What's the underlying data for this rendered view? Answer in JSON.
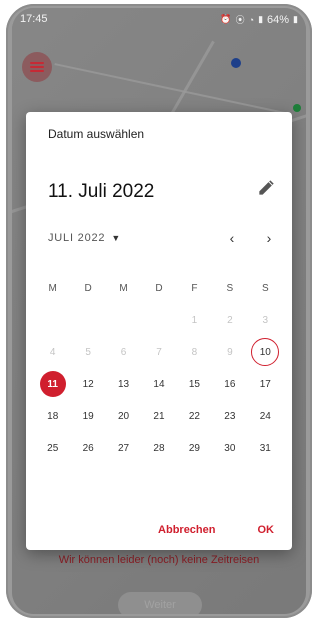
{
  "status_bar": {
    "time": "17:45",
    "icons_left": [
      "notification-icon"
    ],
    "icons_right": [
      "alarm-icon",
      "location-icon",
      "wifi-icon",
      "signal-icon",
      "battery-icon"
    ],
    "battery": "64%"
  },
  "background": {
    "bottom_message": "Wir können leider (noch) keine Zeitreisen",
    "continue_button": "Weiter",
    "accent_red": "#d01f2e"
  },
  "dialog": {
    "subtitle": "Datum auswählen",
    "selected_date": "11. Juli 2022",
    "month_label": "JULI 2022",
    "weekdays": [
      "M",
      "D",
      "M",
      "D",
      "F",
      "S",
      "S"
    ],
    "weeks": [
      [
        "",
        "",
        "",
        "",
        "1",
        "2",
        "3"
      ],
      [
        "4",
        "5",
        "6",
        "7",
        "8",
        "9",
        "10"
      ],
      [
        "11",
        "12",
        "13",
        "14",
        "15",
        "16",
        "17"
      ],
      [
        "18",
        "19",
        "20",
        "21",
        "22",
        "23",
        "24"
      ],
      [
        "25",
        "26",
        "27",
        "28",
        "29",
        "30",
        "31"
      ]
    ],
    "selected_day": "11",
    "today_day": "10",
    "cancel_label": "Abbrechen",
    "ok_label": "OK"
  }
}
